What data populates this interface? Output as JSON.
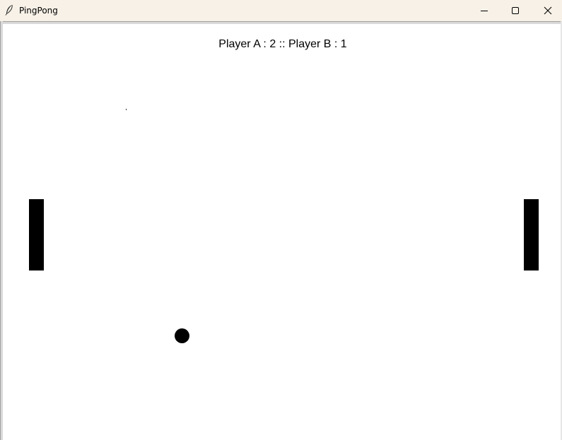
{
  "window": {
    "title": "PingPong",
    "icon": "feather-icon",
    "controls": {
      "minimize_icon": "minimize-icon",
      "maximize_icon": "maximize-icon",
      "close_icon": "close-icon"
    }
  },
  "game": {
    "score_text": "Player A : 2 :: Player B : 1",
    "player_a": {
      "name": "Player A",
      "score": 2
    },
    "player_b": {
      "name": "Player B",
      "score": 1
    },
    "colors": {
      "background": "#ffffff",
      "paddle": "#000000",
      "ball": "#000000",
      "titlebar": "#f7f1e7"
    }
  }
}
